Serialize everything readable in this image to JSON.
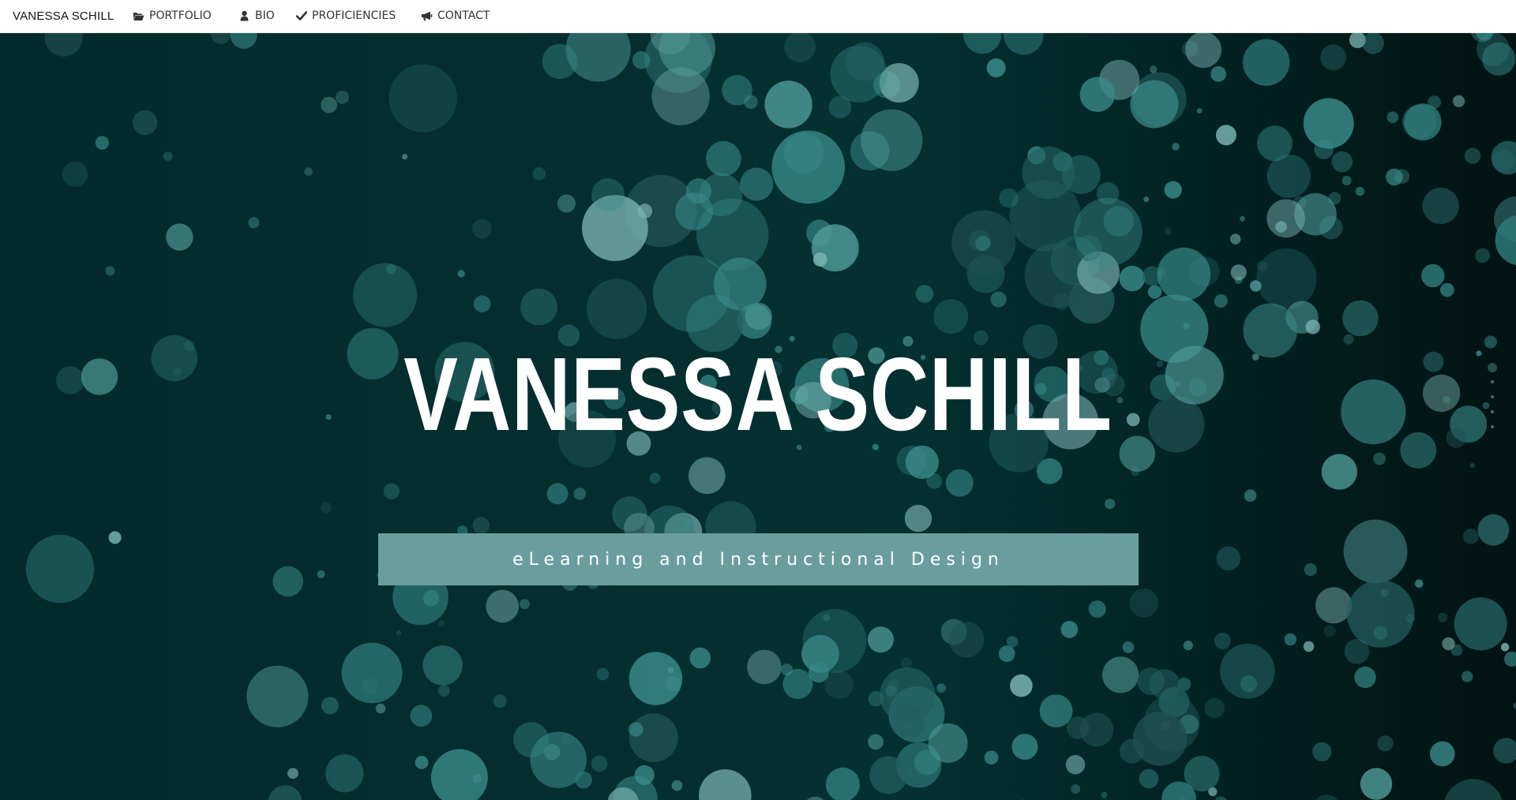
{
  "nav": {
    "brand": "VANESSA SCHILL",
    "items": [
      {
        "label": "PORTFOLIO",
        "icon": "folder-open-icon"
      },
      {
        "label": "BIO",
        "icon": "user-icon"
      },
      {
        "label": "PROFICIENCIES",
        "icon": "checkmark-icon"
      },
      {
        "label": "CONTACT",
        "icon": "bullhorn-icon"
      }
    ]
  },
  "hero": {
    "title": "VANESSA SCHILL",
    "tagline": "eLearning and Instructional Design"
  },
  "page_indicator": {
    "count": 5,
    "active_index": 0
  },
  "colors": {
    "background_dark": "#032a2a",
    "bokeh_teal": "#3a8a8a",
    "bokeh_light": "#7ab4b2",
    "tagline_bar": "#6a9e9e",
    "title_text": "#ffffff"
  }
}
